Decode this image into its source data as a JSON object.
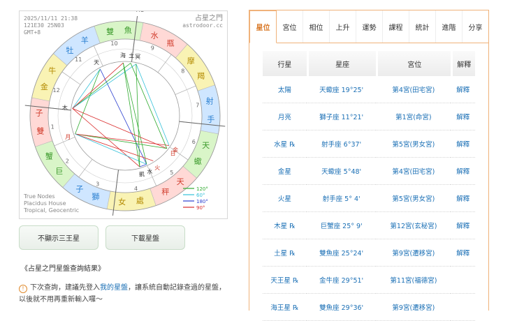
{
  "chart_meta": {
    "datetime": "2025/11/11 21:38",
    "coords": "121E30 25N03",
    "tz": "GMT+8",
    "brand": "占星之門",
    "site": "astrodoor.cc",
    "footer": [
      "True Nodes",
      "Placidus House",
      "Tropical, Geocentric"
    ]
  },
  "chart_labels": {
    "mc": "MC",
    "ic": "IC",
    "asc": "ASC",
    "des": "DES",
    "houses": [
      "1",
      "2",
      "3",
      "4",
      "5",
      "6",
      "7",
      "8",
      "9",
      "10",
      "11",
      "12"
    ],
    "signs": [
      {
        "name": "巨蟹"
      },
      {
        "name": "獅子"
      },
      {
        "name": "處女"
      },
      {
        "name": "天秤"
      },
      {
        "name": "天蠍"
      },
      {
        "name": "射手"
      },
      {
        "name": "摩羯"
      },
      {
        "name": "水瓶"
      },
      {
        "name": "雙魚"
      },
      {
        "name": "牡羊"
      },
      {
        "name": "金牛"
      },
      {
        "name": "雙子"
      }
    ],
    "aspects_legend": [
      {
        "label": "120°",
        "color": "#2eaa2e"
      },
      {
        "label": "60°",
        "color": "#33c1d9"
      },
      {
        "label": "180°",
        "color": "#2b3fd0"
      },
      {
        "label": "90°",
        "color": "#d92b2b"
      }
    ],
    "planet_glyphs": [
      "天",
      "海",
      "土",
      "冥",
      "木",
      "火",
      "水",
      "日",
      "金",
      "月",
      "凱"
    ]
  },
  "buttons": {
    "hide_outer": "不顯示三王星",
    "download": "下載星盤"
  },
  "result_title": "《占星之門星盤查詢結果》",
  "notice": {
    "before": "下次查詢，建議先登入",
    "link": "我的星盤",
    "after": "，讓系統自動記錄查過的星盤，以後就不用再重新輸入囉～"
  },
  "tabs": [
    "星位",
    "宮位",
    "相位",
    "上升",
    "運勢",
    "課程",
    "統計",
    "進階",
    "分享"
  ],
  "table": {
    "headers": [
      "行星",
      "星座",
      "宮位",
      "解釋"
    ],
    "rows": [
      {
        "planet": "太陽",
        "sign": "天蠍座 19°25'",
        "house": "第4宮(田宅宮)",
        "explain": "解釋"
      },
      {
        "planet": "月亮",
        "sign": "獅子座 11°21'",
        "house": "第1宮(命宮)",
        "explain": "解釋"
      },
      {
        "planet": "水星 ℞",
        "sign": "射手座 6°37'",
        "house": "第5宮(男女宮)",
        "explain": "解釋"
      },
      {
        "planet": "金星",
        "sign": "天蠍座 5°48'",
        "house": "第4宮(田宅宮)",
        "explain": "解釋"
      },
      {
        "planet": "火星",
        "sign": "射手座 5° 4'",
        "house": "第5宮(男女宮)",
        "explain": "解釋"
      },
      {
        "planet": "木星 ℞",
        "sign": "巨蟹座 25° 9'",
        "house": "第12宮(玄秘宮)",
        "explain": "解釋"
      },
      {
        "planet": "土星 ℞",
        "sign": "雙魚座 25°24'",
        "house": "第9宮(遷移宮)",
        "explain": "解釋"
      },
      {
        "planet": "天王星 ℞",
        "sign": "金牛座 29°51'",
        "house": "第11宮(福德宮)",
        "explain": ""
      },
      {
        "planet": "海王星 ℞",
        "sign": "雙魚座 29°36'",
        "house": "第9宮(遷移宮)",
        "explain": ""
      }
    ]
  }
}
